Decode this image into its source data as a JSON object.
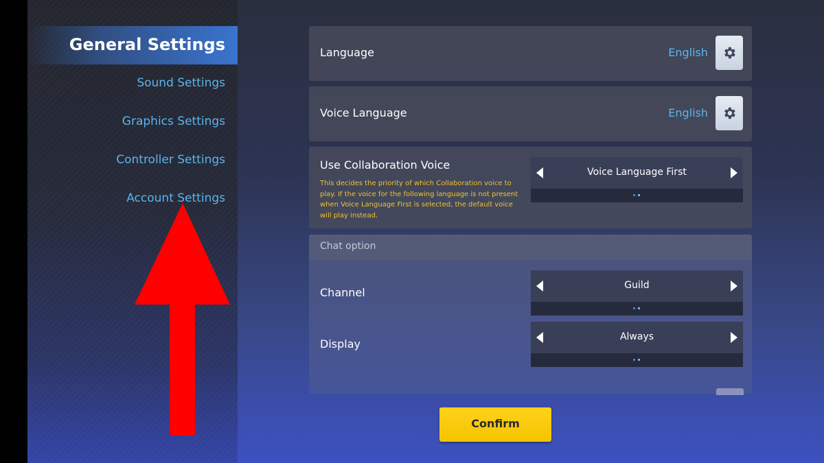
{
  "sidebar": {
    "items": [
      {
        "label": "General Settings",
        "active": true
      },
      {
        "label": "Sound Settings",
        "active": false
      },
      {
        "label": "Graphics Settings",
        "active": false
      },
      {
        "label": "Controller Settings",
        "active": false
      },
      {
        "label": "Account Settings",
        "active": false
      }
    ]
  },
  "settings": {
    "language": {
      "label": "Language",
      "value": "English",
      "icon": "gear-icon"
    },
    "voice_language": {
      "label": "Voice Language",
      "value": "English",
      "icon": "gear-icon"
    },
    "collaboration_voice": {
      "label": "Use Collaboration Voice",
      "description": "This decides the priority of which Collaboration voice to play. If the voice  for the following language is not present when Voice Language First is selected, the default voice will play instead.",
      "value": "Voice Language First"
    }
  },
  "chat_option": {
    "header": "Chat option",
    "channel": {
      "label": "Channel",
      "value": "Guild"
    },
    "display": {
      "label": "Display",
      "value": "Always"
    }
  },
  "footer": {
    "confirm_label": "Confirm"
  },
  "annotation": {
    "arrow_color": "#ff0000",
    "arrow_direction": "up"
  },
  "colors": {
    "accent_blue": "#5bb5ee",
    "active_tab": "#3a74cf",
    "description_text": "#f1c232",
    "confirm_button": "#ffd21a"
  }
}
